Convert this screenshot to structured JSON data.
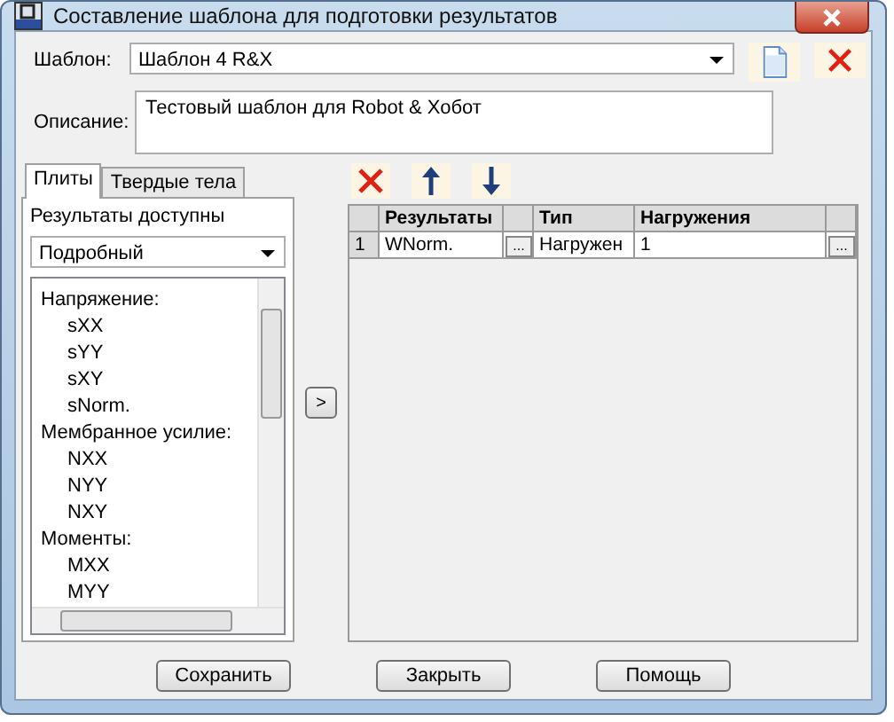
{
  "window": {
    "title": "Составление шаблона для подготовки результатов"
  },
  "template": {
    "label": "Шаблон:",
    "value": "Шаблон 4 R&X"
  },
  "description": {
    "label": "Описание:",
    "value": "Тестовый шаблон для Robot & Хобот"
  },
  "tabs": [
    {
      "label": "Плиты",
      "selected": true
    },
    {
      "label": "Твердые тела",
      "selected": false
    }
  ],
  "available": {
    "label": "Результаты доступны",
    "mode": "Подробный"
  },
  "tree": [
    {
      "label": "Напряжение:",
      "children": [
        {
          "label": "sXX"
        },
        {
          "label": "sYY"
        },
        {
          "label": "sXY"
        },
        {
          "label": "sNorm."
        }
      ]
    },
    {
      "label": "Мембранное усилие:",
      "children": [
        {
          "label": "NXX"
        },
        {
          "label": "NYY"
        },
        {
          "label": "NXY"
        }
      ]
    },
    {
      "label": "Моменты:",
      "children": [
        {
          "label": "MXX"
        },
        {
          "label": "MYY"
        }
      ]
    }
  ],
  "add_button": ">",
  "table": {
    "columns": [
      "Результаты",
      "Тип",
      "Нагружения"
    ],
    "rows": [
      {
        "number": "1",
        "result": "WNorm.",
        "result_button": "...",
        "type": "Нагружен",
        "loads": "1",
        "loads_button": "..."
      }
    ]
  },
  "buttons": [
    "Сохранить",
    "Закрыть",
    "Помощь"
  ]
}
